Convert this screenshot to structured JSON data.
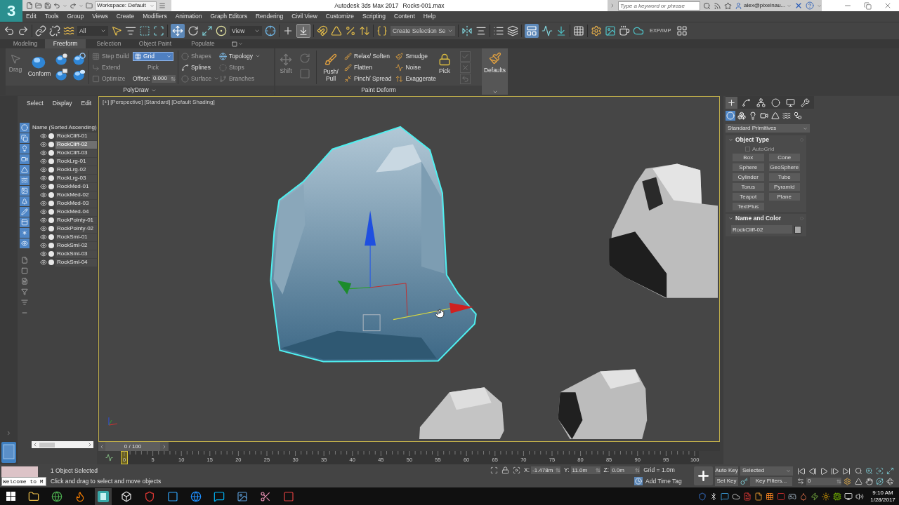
{
  "title_bar": {
    "logo": "3",
    "workspace": "Workspace: Default",
    "app_title": "Autodesk 3ds Max 2017",
    "file_name": "Rocks-001.max",
    "search": {
      "placeholder": "Type a keyword or phrase"
    },
    "user": "alex@pixelnau..."
  },
  "menu": [
    "Edit",
    "Tools",
    "Group",
    "Views",
    "Create",
    "Modifiers",
    "Animation",
    "Graph Editors",
    "Rendering",
    "Civil View",
    "Customize",
    "Scripting",
    "Content",
    "Help"
  ],
  "main_toolbar": {
    "selection_filter": "All",
    "reference_coordinates": "View",
    "selection_set": "Create Selection Se",
    "export_label": "EXP/IMP",
    "move_selected": true,
    "shortcut_override_on": true,
    "ribbon_toggle_on": true
  },
  "ribbon": {
    "tabs": [
      {
        "label": "Modeling",
        "selected": false
      },
      {
        "label": "Freeform",
        "selected": true
      },
      {
        "label": "Selection",
        "selected": false
      },
      {
        "label": "Object Paint",
        "selected": false
      },
      {
        "label": "Populate",
        "selected": false
      }
    ],
    "polydraw": {
      "title": "PolyDraw",
      "drag": {
        "label": "Drag",
        "disabled": true
      },
      "conform": {
        "label": "Conform",
        "disabled": false
      },
      "build_tools": [
        {
          "label": "Step Build",
          "disabled": true
        },
        {
          "label": "Extend",
          "disabled": true
        },
        {
          "label": "Optimize",
          "disabled": true
        }
      ],
      "surface_mode": {
        "label": "Grid",
        "selected": true
      },
      "pick": {
        "label": "Pick",
        "disabled": true
      },
      "offset": {
        "label": "Offset:",
        "value": "0.000"
      },
      "shape_tools": [
        {
          "label": "Shapes",
          "disabled": true,
          "dropdown": false
        },
        {
          "label": "Splines",
          "disabled": false,
          "dropdown": false
        },
        {
          "label": "Surface",
          "disabled": true,
          "dropdown": true
        }
      ],
      "topology_tools": [
        {
          "label": "Topology",
          "disabled": false,
          "dropdown": true
        },
        {
          "label": "Stops",
          "disabled": true,
          "dropdown": false
        },
        {
          "label": "Branches",
          "disabled": true,
          "dropdown": false
        }
      ]
    },
    "paint_deform": {
      "title": "Paint Deform",
      "shift": {
        "label": "Shift",
        "disabled": true
      },
      "push_pull": {
        "label": "Push/ Pull",
        "disabled": false
      },
      "tools": [
        {
          "label": "Relax/ Soften",
          "disabled": false
        },
        {
          "label": "Flatten",
          "disabled": false
        },
        {
          "label": "Pinch/ Spread",
          "disabled": false
        },
        {
          "label": "Smudge",
          "disabled": false
        },
        {
          "label": "Noise",
          "disabled": false
        },
        {
          "label": "Exaggerate",
          "disabled": false
        }
      ],
      "pick": {
        "label": "Pick",
        "disabled": false
      }
    },
    "defaults": {
      "label": "Defaults"
    }
  },
  "scene_explorer": {
    "tabs": [
      "Select",
      "Display",
      "Edit"
    ],
    "filters": [
      {
        "on": true
      },
      {
        "on": true
      },
      {
        "on": true
      },
      {
        "on": true
      },
      {
        "on": true
      },
      {
        "on": true
      },
      {
        "on": true
      },
      {
        "on": true
      },
      {
        "on": true
      },
      {
        "on": true
      },
      {
        "on": true
      },
      {
        "on": true
      }
    ],
    "column_header": "Name (Sorted Ascending)",
    "objects": [
      {
        "name": "RockCliff-01",
        "selected": false
      },
      {
        "name": "RockCliff-02",
        "selected": true
      },
      {
        "name": "RockCliff-03",
        "selected": false
      },
      {
        "name": "RockLrg-01",
        "selected": false
      },
      {
        "name": "RockLrg-02",
        "selected": false
      },
      {
        "name": "RockLrg-03",
        "selected": false
      },
      {
        "name": "RockMed-01",
        "selected": false
      },
      {
        "name": "RockMed-02",
        "selected": false
      },
      {
        "name": "RockMed-03",
        "selected": false
      },
      {
        "name": "RockMed-04",
        "selected": false
      },
      {
        "name": "RockPointy-01",
        "selected": false
      },
      {
        "name": "RockPointy-02",
        "selected": false
      },
      {
        "name": "RockSml-01",
        "selected": false
      },
      {
        "name": "RockSml-02",
        "selected": false
      },
      {
        "name": "RockSml-03",
        "selected": false
      },
      {
        "name": "RockSml-04",
        "selected": false
      }
    ]
  },
  "viewport": {
    "labels": [
      "[+]",
      "[Perspective]",
      "[Standard]",
      "[Default Shading]"
    ]
  },
  "command_panel": {
    "tabs": [
      {
        "selected": true
      },
      {
        "selected": false
      },
      {
        "selected": false
      },
      {
        "selected": false
      },
      {
        "selected": false
      },
      {
        "selected": false
      }
    ],
    "categories": [
      {
        "selected": true
      },
      {
        "selected": false
      },
      {
        "selected": false
      },
      {
        "selected": false
      },
      {
        "selected": false
      },
      {
        "selected": false
      },
      {
        "selected": false
      }
    ],
    "category_list": "Standard Primitives",
    "object_type": {
      "title": "Object Type",
      "autogrid": {
        "label": "AutoGrid",
        "checked": false,
        "disabled": true
      },
      "buttons": [
        "Box",
        "Cone",
        "Sphere",
        "GeoSphere",
        "Cylinder",
        "Tube",
        "Torus",
        "Pyramid",
        "Teapot",
        "Plane",
        "TextPlus"
      ]
    },
    "name_and_color": {
      "title": "Name and Color",
      "name": "RockCliff-02",
      "color": "#a8a8a8"
    }
  },
  "time_slider": {
    "frame": "0 / 100"
  },
  "track_bar": {
    "ticks": [
      "0",
      "5",
      "10",
      "15",
      "20",
      "25",
      "30",
      "35",
      "40",
      "45",
      "50",
      "55",
      "60",
      "65",
      "70",
      "75",
      "80",
      "85",
      "90",
      "95",
      "100"
    ]
  },
  "status_bar": {
    "listener": "Welcome to M",
    "selection": "1 Object Selected",
    "prompt": "Click and drag to select and move objects",
    "coordinates": [
      {
        "label": "X:",
        "value": "-1.478m"
      },
      {
        "label": "Y:",
        "value": "11.0m"
      },
      {
        "label": "Z:",
        "value": "0.0m"
      }
    ],
    "grid": "Grid = 1.0m",
    "time_tag": "Add Time Tag",
    "auto_key": {
      "label": "Auto Key",
      "on": false
    },
    "key_mode": "Selected",
    "set_key": "Set Key",
    "key_filters": "Key Filters...",
    "current_frame": "0"
  },
  "taskbar": {
    "apps": [
      {
        "selected": false
      },
      {
        "selected": false
      },
      {
        "selected": false
      },
      {
        "selected": true
      },
      {
        "selected": false
      },
      {
        "selected": false
      },
      {
        "selected": false
      },
      {
        "selected": false
      },
      {
        "selected": false
      },
      {
        "selected": false
      },
      {
        "selected": false
      },
      {
        "selected": false
      }
    ],
    "time": "9:10 AM",
    "date": "1/28/2017"
  }
}
